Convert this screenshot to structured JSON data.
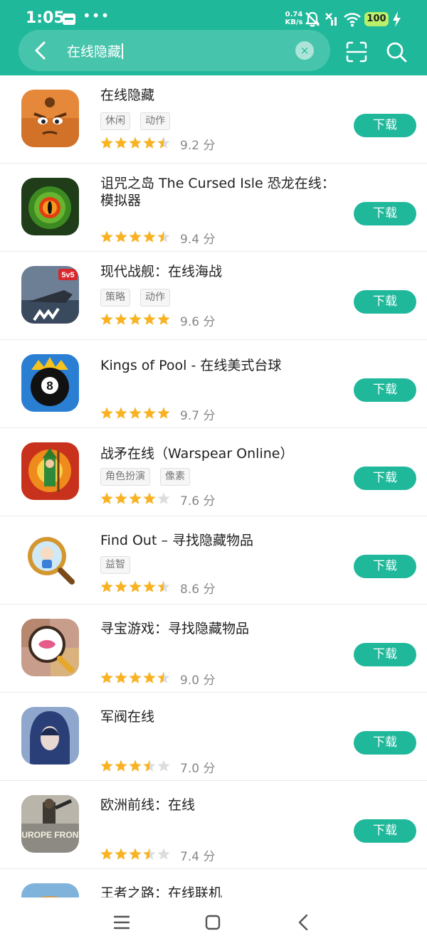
{
  "status_bar": {
    "time": "1:05",
    "dots": "•••",
    "speed_value": "0.74",
    "speed_unit": "KB/s",
    "battery": "100",
    "icons": [
      "calendar-icon",
      "bell-muted-icon",
      "signal-off-icon",
      "wifi-icon",
      "battery-icon",
      "charging-icon"
    ]
  },
  "search": {
    "query": "在线隐藏",
    "clear_label": "×"
  },
  "colors": {
    "brand": "#1fb89a",
    "star": "#f9b322",
    "star_empty": "#dddddd",
    "battery": "#b8f06a"
  },
  "apps": [
    {
      "name": "在线隐藏",
      "tags": [
        "休闲",
        "动作"
      ],
      "stars": 4.5,
      "score": "9.2 分",
      "button": "下载"
    },
    {
      "name": "诅咒之岛 The Cursed Isle 恐龙在线：模拟器",
      "tags": [],
      "stars": 4.5,
      "score": "9.4 分",
      "button": "下载"
    },
    {
      "name": "现代战舰：在线海战",
      "tags": [
        "策略",
        "动作"
      ],
      "stars": 5,
      "score": "9.6 分",
      "button": "下载",
      "icon_badge": "5v5"
    },
    {
      "name": "Kings of Pool - 在线美式台球",
      "tags": [],
      "stars": 5,
      "score": "9.7 分",
      "button": "下载",
      "icon_badge": "8"
    },
    {
      "name": "战矛在线（Warspear Online）",
      "tags": [
        "角色扮演",
        "像素"
      ],
      "stars": 4,
      "score": "7.6 分",
      "button": "下载"
    },
    {
      "name": "Find Out – 寻找隐藏物品",
      "tags": [
        "益智"
      ],
      "stars": 4.5,
      "score": "8.6 分",
      "button": "下载"
    },
    {
      "name": "寻宝游戏：寻找隐藏物品",
      "tags": [],
      "stars": 4.5,
      "score": "9.0 分",
      "button": "下载"
    },
    {
      "name": "军阀在线",
      "tags": [],
      "stars": 3.5,
      "score": "7.0 分",
      "button": "下载"
    },
    {
      "name": "欧洲前线：在线",
      "tags": [],
      "stars": 3.5,
      "score": "7.4 分",
      "button": "下载",
      "icon_badge": "EUROPE FRONT"
    },
    {
      "name": "王者之路：在线联机",
      "tags": [],
      "stars": 0,
      "score": "",
      "button": ""
    }
  ],
  "nav": [
    "menu-icon",
    "home-icon",
    "back-icon"
  ]
}
